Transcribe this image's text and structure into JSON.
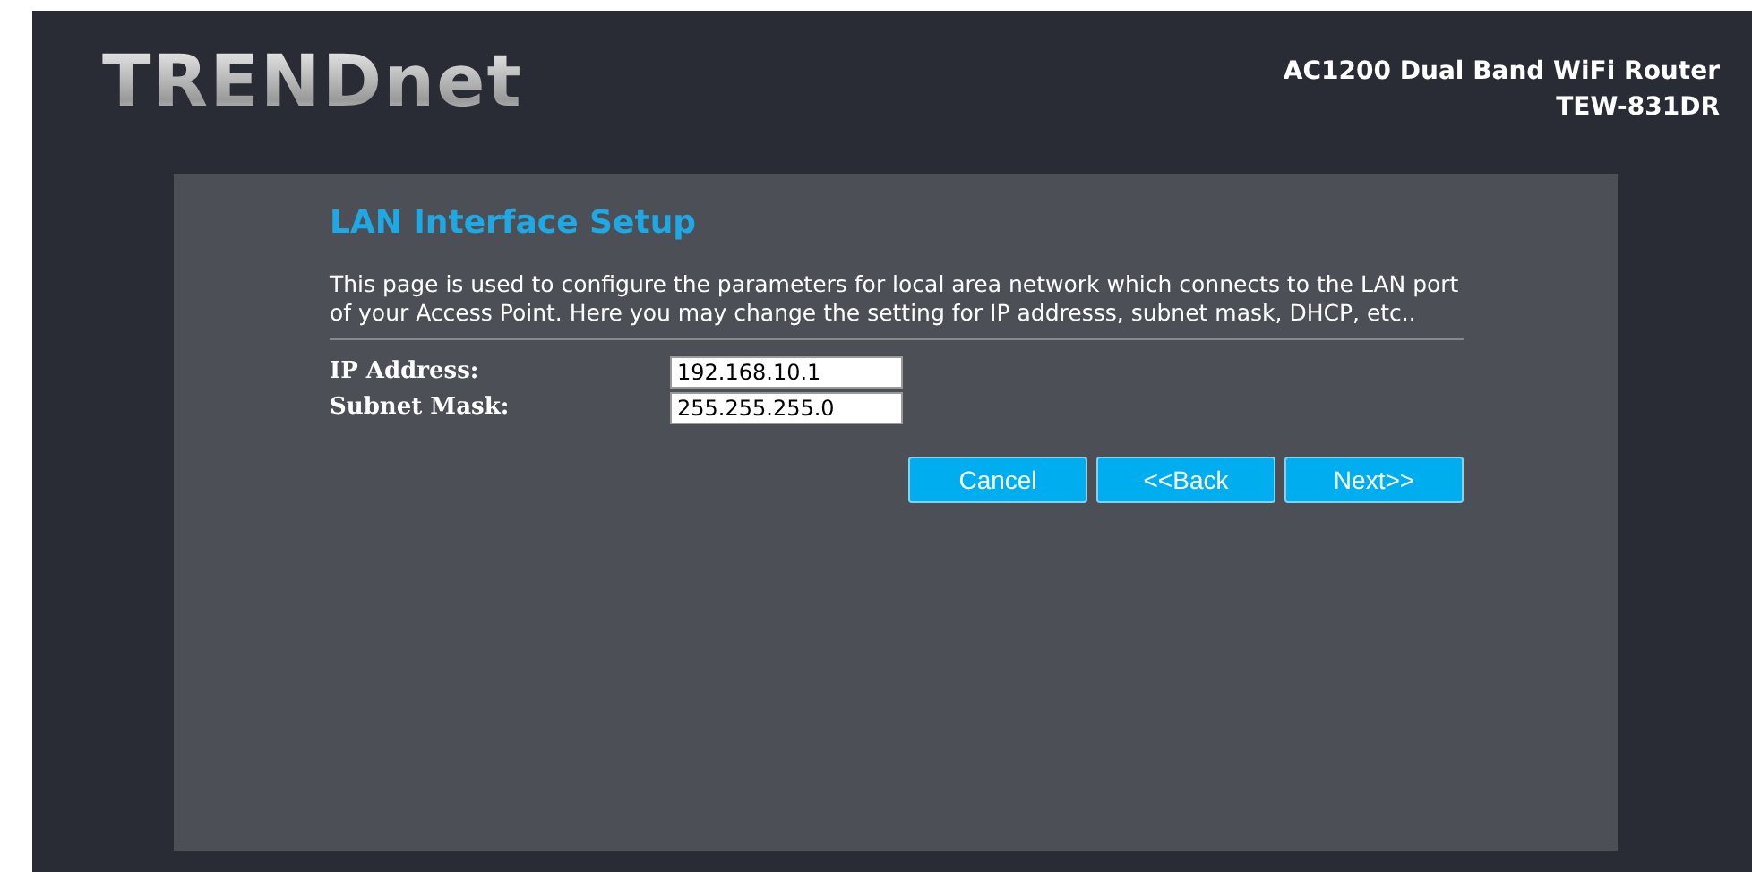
{
  "header": {
    "logo": "TRENDnet",
    "product": "AC1200 Dual Band WiFi Router",
    "model": "TEW-831DR"
  },
  "page": {
    "title": "LAN Interface Setup",
    "description": "This page is used to configure the parameters for local area network which connects to the LAN port of your Access Point. Here you may change the setting for IP addresss, subnet mask, DHCP, etc..",
    "fields": [
      {
        "label": "IP Address:",
        "value": "192.168.10.1"
      },
      {
        "label": "Subnet Mask:",
        "value": "255.255.255.0"
      }
    ],
    "buttons": [
      "Cancel",
      "<<Back",
      "Next>>"
    ]
  }
}
